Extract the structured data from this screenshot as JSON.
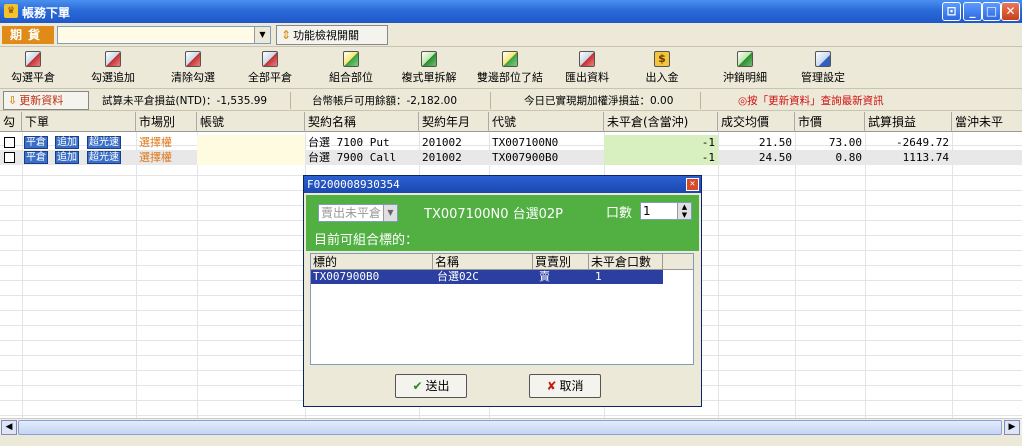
{
  "window": {
    "title": "帳務下單"
  },
  "futures_bar": {
    "label": "期貨",
    "combo_value": "",
    "func_button": "功能檢視開關"
  },
  "toolbar": {
    "items": [
      "勾選平倉",
      "勾選追加",
      "清除勾選",
      "全部平倉",
      "組合部位",
      "複式單拆解",
      "雙邊部位了結",
      "匯出資料",
      "出入金",
      "沖銷明細",
      "管理設定"
    ],
    "money_icon_text": "$"
  },
  "info_bar": {
    "refresh_label": "更新資料",
    "unrealized": "試算未平倉損益(NTD)：-1,535.99",
    "available": "台幣帳戶可用餘額：-2,182.00",
    "realized": "今日已實現期加權淨損益：0.00",
    "hint": "◎按「更新資料」查詢最新資訊"
  },
  "grid": {
    "headers": [
      "勾",
      "下單",
      "市場別",
      "帳號",
      "契約名稱",
      "契約年月",
      "代號",
      "未平倉(含當沖)",
      "成交均價",
      "市價",
      "試算損益",
      "當沖未平"
    ],
    "row_buttons": [
      "平倉",
      "追加",
      "超光速"
    ],
    "rows": [
      {
        "market": "選擇權",
        "account": "",
        "contract": "台選 7100 Put",
        "month": "201002",
        "code": "TX007100N0",
        "open_qty": "-1",
        "avg_price": "21.50",
        "mkt_price": "73.00",
        "pnl": "-2649.72"
      },
      {
        "market": "選擇權",
        "account": "",
        "contract": "台選 7900 Call",
        "month": "201002",
        "code": "TX007900B0",
        "open_qty": "-1",
        "avg_price": "24.50",
        "mkt_price": "0.80",
        "pnl": "1113.74"
      }
    ]
  },
  "dialog": {
    "title": "F0200008930354",
    "side_value": "賣出未平倉",
    "symbol_text": "TX007100N0 台選02P",
    "qty_label": "口數",
    "qty_value": "1",
    "combinable_label": "目前可組合標的：",
    "list_headers": [
      "標的",
      "名稱",
      "買賣別",
      "未平倉口數"
    ],
    "list_rows": [
      {
        "symbol": "TX007900B0",
        "name": "台選02C",
        "side": "賣",
        "qty": "1"
      }
    ],
    "ok_label": "送出",
    "cancel_label": "取消"
  }
}
